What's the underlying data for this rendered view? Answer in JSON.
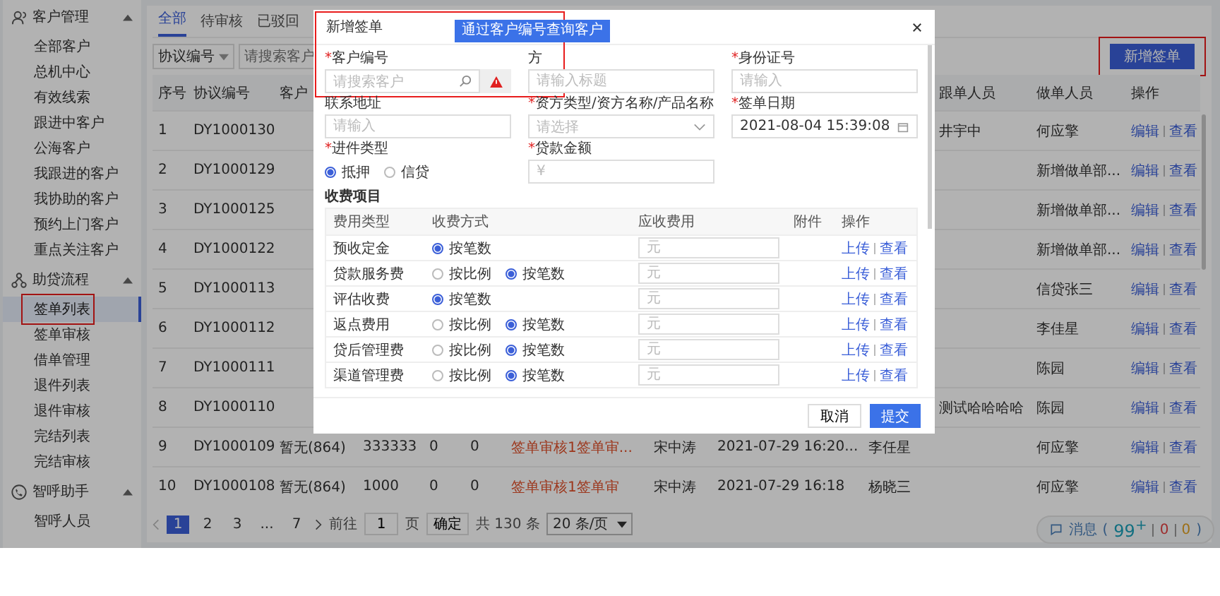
{
  "sidebar": {
    "groups": [
      {
        "label": "客户管理",
        "expanded": true,
        "items": [
          {
            "label": "全部客户",
            "selected": false,
            "highlighted": false
          },
          {
            "label": "总机中心",
            "selected": false,
            "highlighted": false
          },
          {
            "label": "有效线索",
            "selected": false,
            "highlighted": false
          },
          {
            "label": "跟进中客户",
            "selected": false,
            "highlighted": false
          },
          {
            "label": "公海客户",
            "selected": false,
            "highlighted": false
          },
          {
            "label": "我跟进的客户",
            "selected": false,
            "highlighted": false
          },
          {
            "label": "我协助的客户",
            "selected": false,
            "highlighted": false
          },
          {
            "label": "预约上门客户",
            "selected": false,
            "highlighted": false
          },
          {
            "label": "重点关注客户",
            "selected": false,
            "highlighted": false
          }
        ]
      },
      {
        "label": "助贷流程",
        "expanded": true,
        "items": [
          {
            "label": "签单列表",
            "selected": true,
            "highlighted": true
          },
          {
            "label": "签单审核",
            "selected": false,
            "highlighted": false
          },
          {
            "label": "借单管理",
            "selected": false,
            "highlighted": false
          },
          {
            "label": "退件列表",
            "selected": false,
            "highlighted": false
          },
          {
            "label": "退件审核",
            "selected": false,
            "highlighted": false
          },
          {
            "label": "完结列表",
            "selected": false,
            "highlighted": false
          },
          {
            "label": "完结审核",
            "selected": false,
            "highlighted": false
          }
        ]
      },
      {
        "label": "智呼助手",
        "expanded": true,
        "items": [
          {
            "label": "智呼人员",
            "selected": false,
            "highlighted": false
          }
        ]
      }
    ]
  },
  "tabs": [
    {
      "label": "全部",
      "selected": true
    },
    {
      "label": "待审核",
      "selected": false
    },
    {
      "label": "已驳回",
      "selected": false
    }
  ],
  "filter": {
    "select": "协议编号",
    "placeholder": "请搜索客户"
  },
  "add_button": {
    "label": "新增签单",
    "highlighted": true
  },
  "table": {
    "columns": {
      "no": "序号",
      "code": "协议编号",
      "customer": "客户",
      "follower": "跟单人员",
      "maker": "做单人员",
      "actions": "操作"
    },
    "rows": [
      {
        "no": "1",
        "code": "DY1000130",
        "follower": "井宇中",
        "maker": "何应擎",
        "actions": [
          "编辑",
          "查看"
        ]
      },
      {
        "no": "2",
        "code": "DY1000129",
        "maker": "新增做单部...",
        "actions": [
          "编辑",
          "查看"
        ]
      },
      {
        "no": "3",
        "code": "DY1000125",
        "maker": "新增做单部...",
        "actions": [
          "编辑",
          "查看"
        ]
      },
      {
        "no": "4",
        "code": "DY1000122",
        "maker": "新增做单部...",
        "actions": [
          "编辑",
          "查看"
        ]
      },
      {
        "no": "5",
        "code": "DY1000113",
        "maker": "信贷张三",
        "actions": [
          "编辑",
          "查看"
        ]
      },
      {
        "no": "6",
        "code": "DY1000112",
        "maker": "李佳星",
        "actions": [
          "编辑",
          "查看"
        ]
      },
      {
        "no": "7",
        "code": "DY1000111",
        "maker": "陈园",
        "actions": [
          "编辑",
          "查看"
        ]
      },
      {
        "no": "8",
        "code": "DY1000110",
        "follower": "测试哈哈哈哈",
        "maker": "陈园",
        "actions": [
          "编辑",
          "查看"
        ]
      },
      {
        "no": "9",
        "code": "DY1000109",
        "customer": "暂无(864)",
        "amount": "333333",
        "c5": "0",
        "c6": "0",
        "status": "签单审核1签单审...",
        "person": "宋中涛",
        "date": "2021-07-29 16:20...",
        "signer": "李任星",
        "maker": "何应擎",
        "actions": [
          "编辑",
          "查看"
        ]
      },
      {
        "no": "10",
        "code": "DY1000108",
        "customer": "暂无(864)",
        "amount": "1000",
        "c5": "0",
        "c6": "0",
        "status": "签单审核1签单审",
        "person": "宋中涛",
        "date": "2021-07-29 16:18",
        "signer": "杨晓三",
        "maker": "何应擎",
        "actions": [
          "编辑",
          "查看"
        ]
      }
    ]
  },
  "pagination": {
    "pages": [
      {
        "label": "1",
        "selected": true
      },
      {
        "label": "2",
        "selected": false
      },
      {
        "label": "3",
        "selected": false
      },
      {
        "label": "...",
        "selected": false
      },
      {
        "label": "7",
        "selected": false
      }
    ],
    "goto": "前往",
    "page_value": "1",
    "page_unit": "页",
    "confirm": "确定",
    "total": "共 130 条",
    "page_size": "20 条/页"
  },
  "messages": {
    "label": "消息",
    "open": "(",
    "count": "99$^{+}$",
    "red": "0",
    "orange": "0",
    "close": ")"
  },
  "modal": {
    "title": "新增签单",
    "highlighted": true,
    "tooltip": "通过客户编号查询客户",
    "fields": [
      {
        "kind": "search",
        "marker": "*",
        "label": "客户编号",
        "placeholder": "请搜索客户"
      },
      {
        "kind": "text",
        "label": "方",
        "placeholder": "请输入标题"
      },
      {
        "kind": "text",
        "marker": "*",
        "label": "身份证号",
        "placeholder": "请输入"
      },
      {
        "kind": "text",
        "label": "联系地址",
        "placeholder": "请输入"
      },
      {
        "kind": "select",
        "marker": "*",
        "label": "资方类型/资方名称/产品名称",
        "placeholder": "请选择"
      },
      {
        "kind": "date",
        "marker": "*",
        "label": "签单日期",
        "value": "2021-08-04 15:39:08"
      },
      {
        "kind": "radio",
        "marker": "*",
        "label": "进件类型",
        "options": [
          {
            "label": "抵押",
            "selected": true
          },
          {
            "label": "信贷",
            "selected": false
          }
        ]
      },
      {
        "kind": "text",
        "marker": "*",
        "label": "贷款金额",
        "placeholder": "¥"
      }
    ],
    "fees_title": "收费项目",
    "fee_columns": [
      "费用类型",
      "收费方式",
      "应收费用",
      "附件",
      "操作"
    ],
    "fees": [
      {
        "type": "预收定金",
        "methods": [
          {
            "label": "按笔数",
            "selected": true
          }
        ],
        "placeholder": "元",
        "actions": [
          "上传",
          "查看"
        ]
      },
      {
        "type": "贷款服务费",
        "methods": [
          {
            "label": "按比例",
            "selected": false
          },
          {
            "label": "按笔数",
            "selected": true
          }
        ],
        "placeholder": "元",
        "actions": [
          "上传",
          "查看"
        ]
      },
      {
        "type": "评估收费",
        "methods": [
          {
            "label": "按笔数",
            "selected": true
          }
        ],
        "placeholder": "元",
        "actions": [
          "上传",
          "查看"
        ]
      },
      {
        "type": "返点费用",
        "methods": [
          {
            "label": "按比例",
            "selected": false
          },
          {
            "label": "按笔数",
            "selected": true
          }
        ],
        "placeholder": "元",
        "actions": [
          "上传",
          "查看"
        ]
      },
      {
        "type": "贷后管理费",
        "methods": [
          {
            "label": "按比例",
            "selected": false
          },
          {
            "label": "按笔数",
            "selected": true
          }
        ],
        "placeholder": "元",
        "actions": [
          "上传",
          "查看"
        ]
      },
      {
        "type": "渠道管理费",
        "methods": [
          {
            "label": "按比例",
            "selected": false
          },
          {
            "label": "按笔数",
            "selected": true
          }
        ],
        "placeholder": "元",
        "actions": [
          "上传",
          "查看"
        ]
      }
    ],
    "cancel": "取消",
    "submit": "提交"
  }
}
